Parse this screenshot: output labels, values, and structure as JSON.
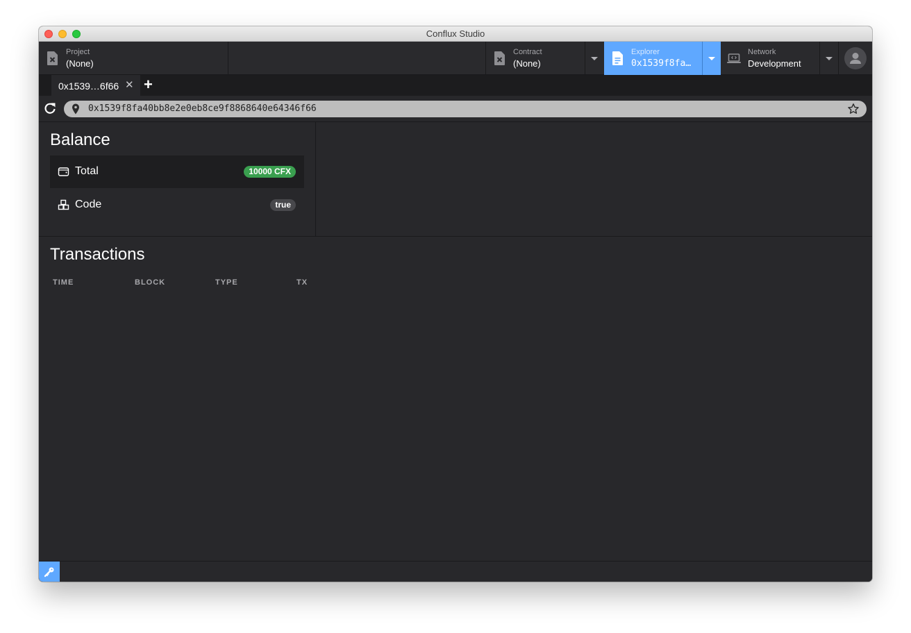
{
  "window": {
    "title": "Conflux Studio"
  },
  "header": {
    "project": {
      "label": "Project",
      "value": "(None)",
      "icon": "file-x-icon"
    },
    "contract": {
      "label": "Contract",
      "value": "(None)",
      "icon": "file-x-icon"
    },
    "explorer": {
      "label": "Explorer",
      "value": "0x1539f8fa…",
      "icon": "document-icon",
      "accent": "#5fa8ff"
    },
    "network": {
      "label": "Network",
      "value": "Development",
      "icon": "laptop-code-icon"
    },
    "avatar_icon": "user-icon"
  },
  "tabs": [
    {
      "label": "0x1539…6f66"
    }
  ],
  "address_bar": {
    "value": "0x1539f8fa40bb8e2e0eb8ce9f8868640e64346f66"
  },
  "balance": {
    "title": "Balance",
    "rows": [
      {
        "label": "Total",
        "value": "10000 CFX",
        "icon": "wallet-icon",
        "color": "#3a9f4f"
      },
      {
        "label": "Code",
        "value": "true",
        "icon": "cubes-icon"
      }
    ]
  },
  "transactions": {
    "title": "Transactions",
    "columns": [
      "TIME",
      "BLOCK",
      "TYPE",
      "TX"
    ]
  },
  "bottombar": {
    "key_icon": "key-icon",
    "accent": "#5fa8ff"
  }
}
